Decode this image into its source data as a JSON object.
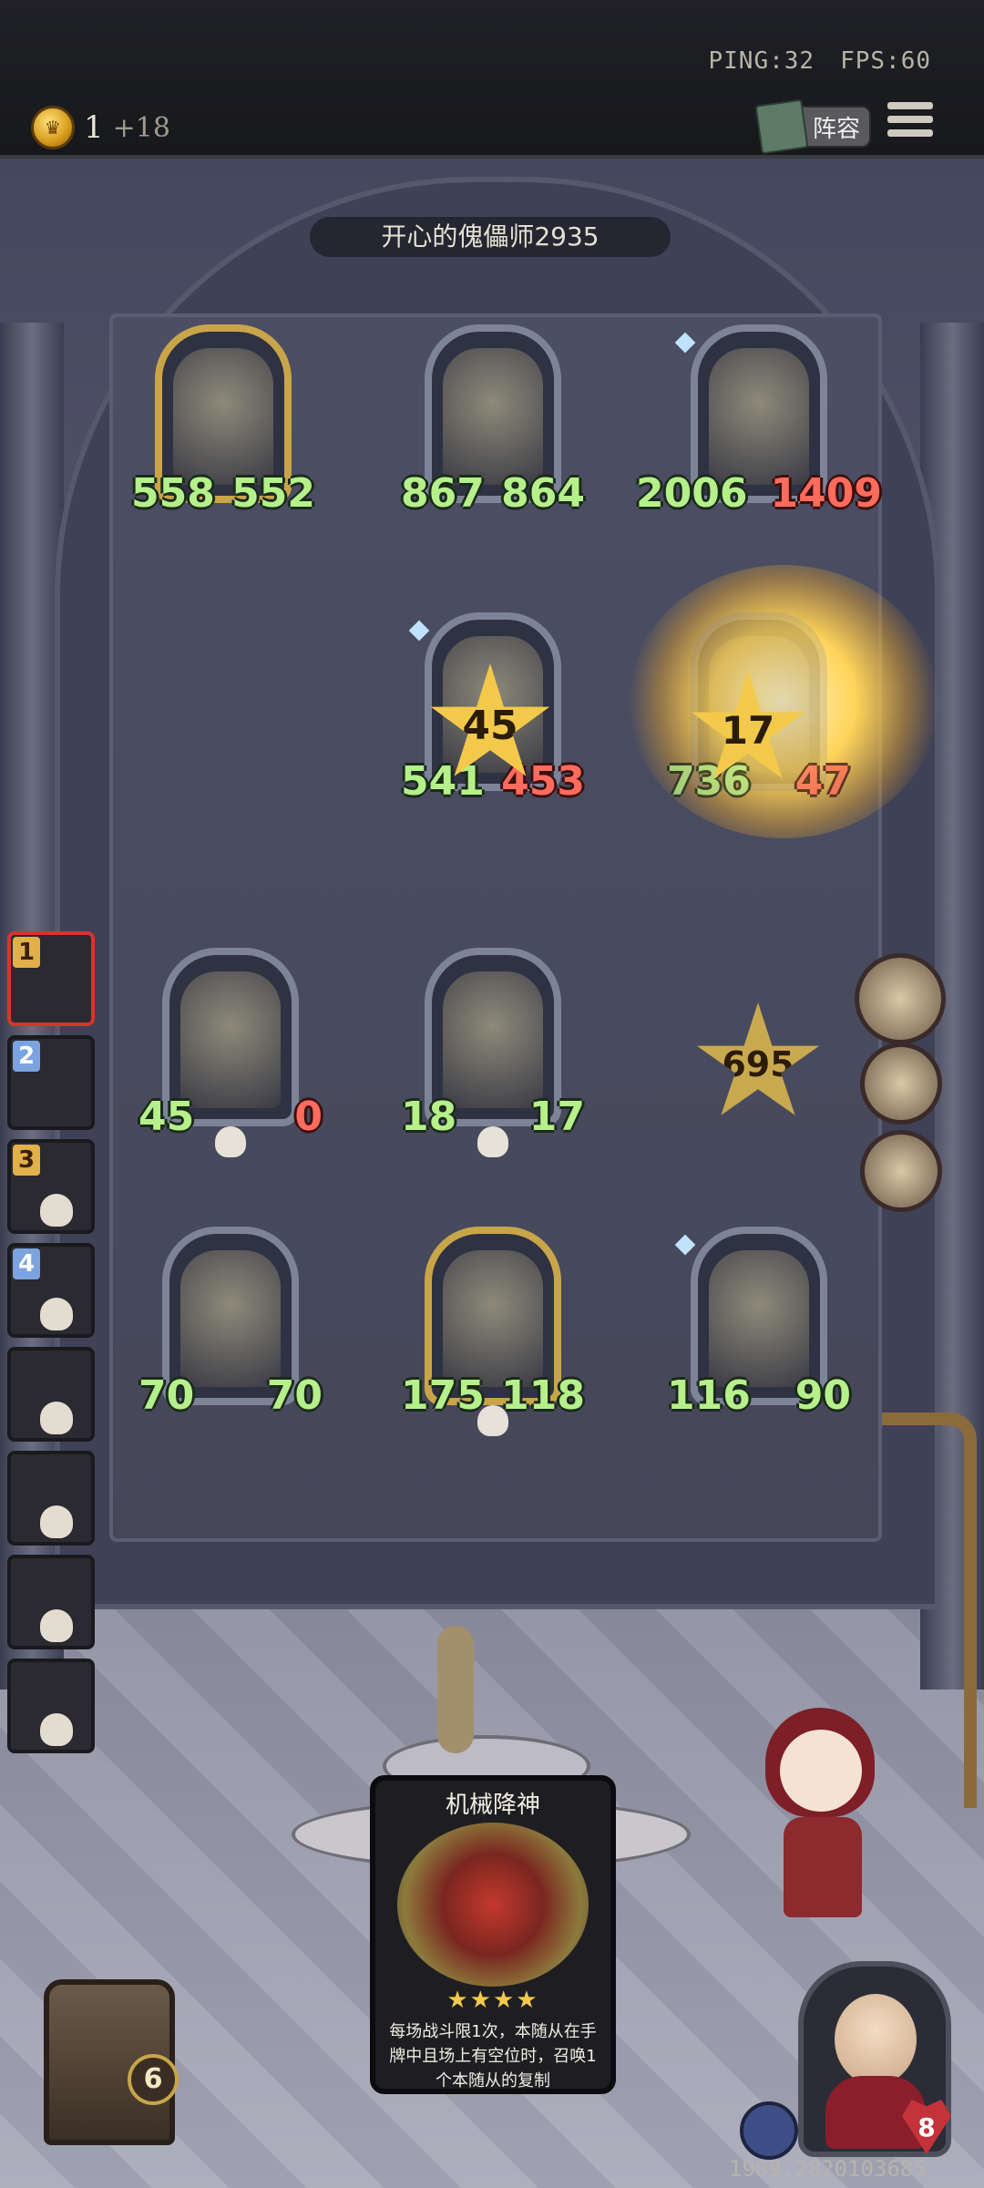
{
  "status": {
    "ping": "PING:32",
    "fps": "FPS:60"
  },
  "gold": {
    "count": "1",
    "bonus": "+18"
  },
  "top_buttons": {
    "lineup_label": "阵容"
  },
  "opponent": {
    "name": "开心的傀儡师2935"
  },
  "board": {
    "minions": [
      {
        "atk": "558",
        "hp": "552",
        "hp_damaged": false
      },
      {
        "atk": "867",
        "hp": "864",
        "hp_damaged": false
      },
      {
        "atk": "2006",
        "hp": "1409",
        "hp_damaged": true
      },
      {
        "atk": "541",
        "hp": "453",
        "hp_damaged": true
      },
      {
        "atk": "736",
        "hp": "47",
        "hp_damaged": true
      },
      {
        "atk": "45",
        "hp": "0",
        "hp_damaged": true
      },
      {
        "atk": "18",
        "hp": "17",
        "hp_damaged": false
      },
      {
        "atk": "70",
        "hp": "70",
        "hp_damaged": false
      },
      {
        "atk": "175",
        "hp": "118",
        "hp_damaged": false
      },
      {
        "atk": "116",
        "hp": "90",
        "hp_damaged": false
      }
    ],
    "damage_bursts": [
      "45",
      "17",
      "695"
    ]
  },
  "opponent_queue": [
    {
      "rank": "1",
      "active": true
    },
    {
      "rank": "2",
      "active": false
    },
    {
      "rank": "3",
      "active": false
    },
    {
      "rank": "4",
      "active": false
    },
    {
      "rank": "",
      "active": false
    },
    {
      "rank": "",
      "active": false
    },
    {
      "rank": "",
      "active": false
    },
    {
      "rank": "",
      "active": false
    }
  ],
  "card": {
    "title": "机械降神",
    "stars": "★★★★",
    "description": "每场战斗限1次，本随从在手牌中且场上有空位时，召唤1个本随从的复制"
  },
  "tavern": {
    "level": "6"
  },
  "hero": {
    "health": "8"
  },
  "coordinates": "1909.2820103685",
  "colors": {
    "atk_green": "#b5f08a",
    "damage_red": "#ff6b5c",
    "gold": "#f3c94b"
  }
}
